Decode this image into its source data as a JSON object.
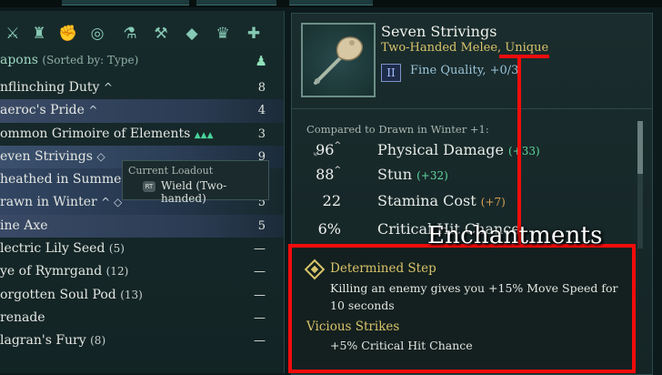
{
  "category_icons": [
    {
      "name": "crossed-swords-icon",
      "glyph": "⚔"
    },
    {
      "name": "armor-icon",
      "glyph": "♜"
    },
    {
      "name": "gauntlet-icon",
      "glyph": "✊"
    },
    {
      "name": "rings-icon",
      "glyph": "◎"
    },
    {
      "name": "flask-icon",
      "glyph": "⚗"
    },
    {
      "name": "anvil-icon",
      "glyph": "⚒"
    },
    {
      "name": "gem-icon",
      "glyph": "◆"
    },
    {
      "name": "crown-icon",
      "glyph": "♛"
    },
    {
      "name": "dpad-icon",
      "glyph": "✚"
    }
  ],
  "list": {
    "title": "apons",
    "sort": "(Sorted by: Type)",
    "rows": [
      {
        "name": "nflinching Duty",
        "marker": "^",
        "num": "8"
      },
      {
        "name": "aeroc's Pride",
        "marker": "^",
        "num": "4"
      },
      {
        "name": "ommon Grimoire of Elements",
        "marker": "",
        "extra": "▲▲▲",
        "num": "3"
      },
      {
        "name": "even Strivings",
        "marker": "◇",
        "num": "9"
      },
      {
        "name": "heathed in Summer",
        "marker": "◇",
        "num": "3.5"
      },
      {
        "name": "rawn in Winter",
        "marker": "^ ◇",
        "num": "5"
      },
      {
        "name": "ine Axe",
        "marker": "",
        "num": "5"
      },
      {
        "name": "lectric Lily Seed",
        "count": "(5)",
        "num": "—"
      },
      {
        "name": "ye of Rymrgand",
        "count": "(12)",
        "num": "—"
      },
      {
        "name": "orgotten Soul Pod",
        "count": "(13)",
        "num": "—"
      },
      {
        "name": "renade",
        "count": "",
        "num": "—"
      },
      {
        "name": "lagran's Fury",
        "count": "(8)",
        "num": "—"
      }
    ]
  },
  "tooltip": {
    "title": "Current Loadout",
    "button": "RT",
    "action": "Wield (Two-handed)"
  },
  "item": {
    "name": "Seven Strivings",
    "type": "Two-Handed Melee, Unique",
    "quality_tier": "II",
    "quality": "Fine Quality, +0/3",
    "compare": "Compared to Drawn in Winter +1:",
    "stats": [
      {
        "icon": "sword-icon",
        "glyph": "⸔",
        "value": "96",
        "caret": "^",
        "label": "Physical Damage",
        "delta": "(+33)",
        "delta_color": "green"
      },
      {
        "icon": "",
        "glyph": "",
        "value": "88",
        "caret": "^",
        "label": "Stun",
        "delta": "(+32)",
        "delta_color": "green"
      },
      {
        "icon": "",
        "glyph": "",
        "value": "22",
        "caret": "",
        "label": "Stamina Cost",
        "delta": "(+7)",
        "delta_color": "orange"
      },
      {
        "icon": "",
        "glyph": "",
        "value": "6%",
        "caret": "",
        "label": "Critical Hit Chance",
        "delta": "",
        "delta_color": ""
      }
    ]
  },
  "annotation": {
    "label": "Enchantments"
  },
  "enchantments": [
    {
      "name": "Determined Step",
      "desc": "Killing an enemy gives you +15% Move Speed for 10 seconds"
    },
    {
      "name": "Vicious Strikes",
      "desc": "+5% Critical Hit Chance"
    }
  ]
}
